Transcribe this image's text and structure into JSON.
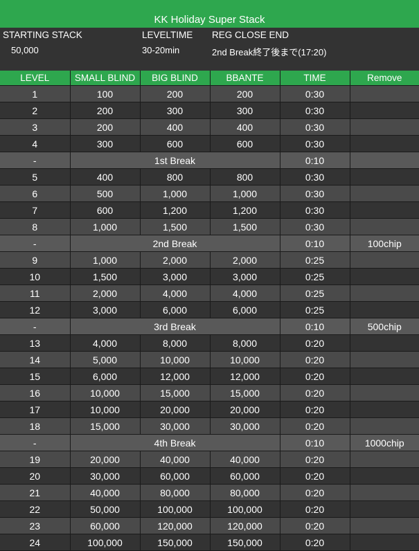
{
  "title": "KK Holiday Super Stack",
  "info": {
    "starting_stack_label": "STARTING STACK",
    "starting_stack_value": "50,000",
    "level_time_label": "LEVELTIME",
    "level_time_value": "30-20min",
    "reg_close_label": "REG CLOSE END",
    "reg_close_value": "2nd Break終了後まで(17:20)"
  },
  "columns": [
    "LEVEL",
    "SMALL BLIND",
    "BIG BLIND",
    "BBANTE",
    "TIME",
    "Remove"
  ],
  "rows": [
    {
      "level": "1",
      "sb": "100",
      "bb": "200",
      "ante": "200",
      "time": "0:30",
      "remove": ""
    },
    {
      "level": "2",
      "sb": "200",
      "bb": "300",
      "ante": "300",
      "time": "0:30",
      "remove": ""
    },
    {
      "level": "3",
      "sb": "200",
      "bb": "400",
      "ante": "400",
      "time": "0:30",
      "remove": ""
    },
    {
      "level": "4",
      "sb": "300",
      "bb": "600",
      "ante": "600",
      "time": "0:30",
      "remove": ""
    },
    {
      "break": true,
      "level": "-",
      "name": "1st Break",
      "time": "0:10",
      "remove": ""
    },
    {
      "level": "5",
      "sb": "400",
      "bb": "800",
      "ante": "800",
      "time": "0:30",
      "remove": ""
    },
    {
      "level": "6",
      "sb": "500",
      "bb": "1,000",
      "ante": "1,000",
      "time": "0:30",
      "remove": ""
    },
    {
      "level": "7",
      "sb": "600",
      "bb": "1,200",
      "ante": "1,200",
      "time": "0:30",
      "remove": ""
    },
    {
      "level": "8",
      "sb": "1,000",
      "bb": "1,500",
      "ante": "1,500",
      "time": "0:30",
      "remove": ""
    },
    {
      "break": true,
      "level": "-",
      "name": "2nd Break",
      "time": "0:10",
      "remove": "100chip"
    },
    {
      "level": "9",
      "sb": "1,000",
      "bb": "2,000",
      "ante": "2,000",
      "time": "0:25",
      "remove": ""
    },
    {
      "level": "10",
      "sb": "1,500",
      "bb": "3,000",
      "ante": "3,000",
      "time": "0:25",
      "remove": ""
    },
    {
      "level": "11",
      "sb": "2,000",
      "bb": "4,000",
      "ante": "4,000",
      "time": "0:25",
      "remove": ""
    },
    {
      "level": "12",
      "sb": "3,000",
      "bb": "6,000",
      "ante": "6,000",
      "time": "0:25",
      "remove": ""
    },
    {
      "break": true,
      "level": "-",
      "name": "3rd Break",
      "time": "0:10",
      "remove": "500chip"
    },
    {
      "level": "13",
      "sb": "4,000",
      "bb": "8,000",
      "ante": "8,000",
      "time": "0:20",
      "remove": ""
    },
    {
      "level": "14",
      "sb": "5,000",
      "bb": "10,000",
      "ante": "10,000",
      "time": "0:20",
      "remove": ""
    },
    {
      "level": "15",
      "sb": "6,000",
      "bb": "12,000",
      "ante": "12,000",
      "time": "0:20",
      "remove": ""
    },
    {
      "level": "16",
      "sb": "10,000",
      "bb": "15,000",
      "ante": "15,000",
      "time": "0:20",
      "remove": ""
    },
    {
      "level": "17",
      "sb": "10,000",
      "bb": "20,000",
      "ante": "20,000",
      "time": "0:20",
      "remove": ""
    },
    {
      "level": "18",
      "sb": "15,000",
      "bb": "30,000",
      "ante": "30,000",
      "time": "0:20",
      "remove": ""
    },
    {
      "break": true,
      "level": "-",
      "name": "4th Break",
      "time": "0:10",
      "remove": "1000chip"
    },
    {
      "level": "19",
      "sb": "20,000",
      "bb": "40,000",
      "ante": "40,000",
      "time": "0:20",
      "remove": ""
    },
    {
      "level": "20",
      "sb": "30,000",
      "bb": "60,000",
      "ante": "60,000",
      "time": "0:20",
      "remove": ""
    },
    {
      "level": "21",
      "sb": "40,000",
      "bb": "80,000",
      "ante": "80,000",
      "time": "0:20",
      "remove": ""
    },
    {
      "level": "22",
      "sb": "50,000",
      "bb": "100,000",
      "ante": "100,000",
      "time": "0:20",
      "remove": ""
    },
    {
      "level": "23",
      "sb": "60,000",
      "bb": "120,000",
      "ante": "120,000",
      "time": "0:20",
      "remove": ""
    },
    {
      "level": "24",
      "sb": "100,000",
      "bb": "150,000",
      "ante": "150,000",
      "time": "0:20",
      "remove": ""
    }
  ]
}
